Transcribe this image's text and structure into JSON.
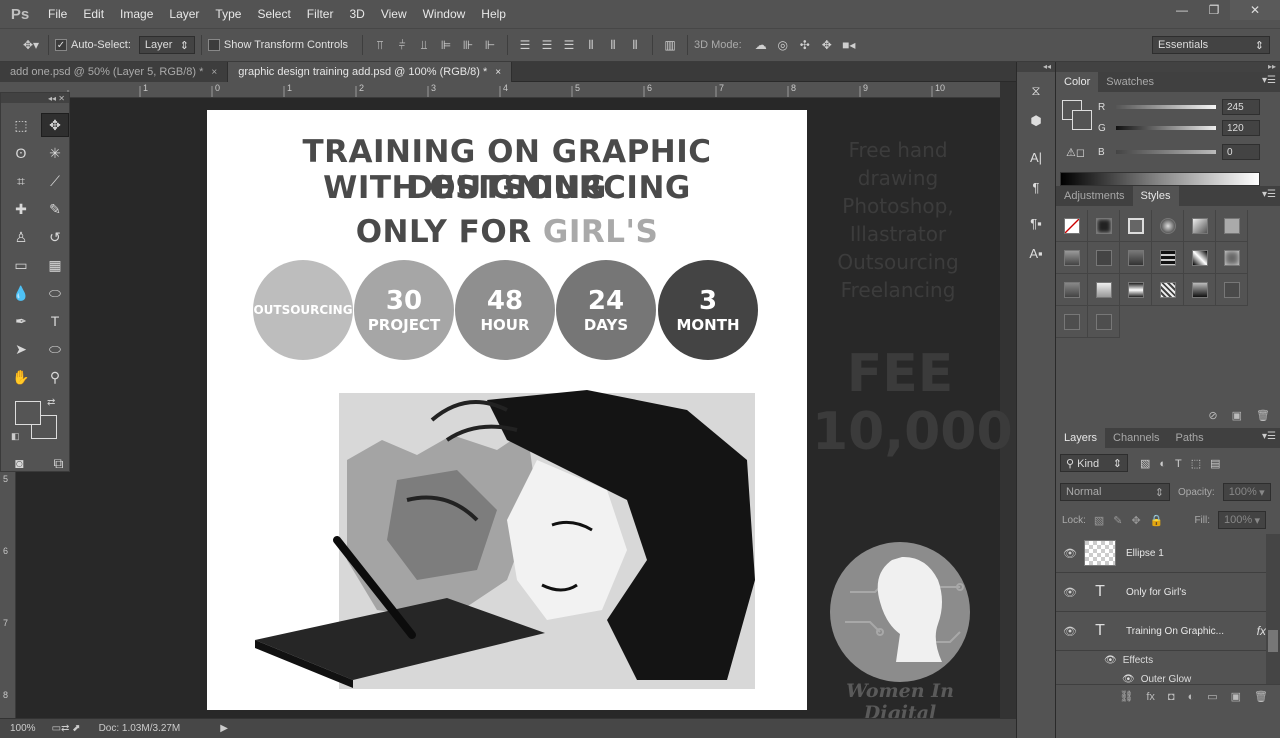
{
  "app": {
    "logo": "Ps"
  },
  "menu": [
    "File",
    "Edit",
    "Image",
    "Layer",
    "Type",
    "Select",
    "Filter",
    "3D",
    "View",
    "Window",
    "Help"
  ],
  "window_controls": {
    "minimize": "—",
    "restore": "❐",
    "close": "✕"
  },
  "options": {
    "auto_select_label": "Auto-Select:",
    "auto_select_value": "Layer",
    "show_transform_label": "Show Transform Controls",
    "mode_3d_label": "3D Mode:",
    "workspace": "Essentials"
  },
  "tabs": [
    {
      "title": "add one.psd @ 50% (Layer 5, RGB/8) *",
      "close": "×"
    },
    {
      "title": "graphic design training add.psd @ 100% (RGB/8) *",
      "close": "×"
    }
  ],
  "ruler": {
    "h": [
      "1",
      "0",
      "1",
      "2",
      "3",
      "4",
      "5",
      "6",
      "7",
      "8",
      "9",
      "10"
    ],
    "v": [
      "5",
      "6",
      "7",
      "8"
    ]
  },
  "status": {
    "zoom": "100%",
    "doc": "Doc: 1.03M/3.27M"
  },
  "poster": {
    "title1": "TRAINING ON GRAPHIC DESIGNING",
    "title2": "WITH OUTSOURCING",
    "only_for": "ONLY FOR",
    "girls": "GIRL'S",
    "circles": [
      {
        "num": "",
        "label": "OUTSOURCING",
        "color": "#bdbdbd"
      },
      {
        "num": "30",
        "label": "PROJECT",
        "color": "#a6a6a6"
      },
      {
        "num": "48",
        "label": "HOUR",
        "color": "#8f8f8f"
      },
      {
        "num": "24",
        "label": "DAYS",
        "color": "#767676"
      },
      {
        "num": "3",
        "label": "MONTH",
        "color": "#444444"
      }
    ]
  },
  "side_text": [
    "Free hand drawing",
    "Photoshop,",
    "Illastrator",
    "Outsourcing",
    "Freelancing"
  ],
  "fee": {
    "label": "FEE",
    "amount": "10,000"
  },
  "logo_text": "Women In Digital",
  "color_panel": {
    "tabs": [
      "Color",
      "Swatches"
    ],
    "r_label": "R",
    "r": "245",
    "g_label": "G",
    "g": "120",
    "b_label": "B",
    "b": "0"
  },
  "styles_panel": {
    "tabs": [
      "Adjustments",
      "Styles"
    ]
  },
  "layers_panel": {
    "tabs": [
      "Layers",
      "Channels",
      "Paths"
    ],
    "kind": "Kind",
    "blend": "Normal",
    "opacity_label": "Opacity:",
    "opacity": "100%",
    "lock_label": "Lock:",
    "fill_label": "Fill:",
    "fill": "100%",
    "layers": [
      {
        "name": "Ellipse 1",
        "thumb": ""
      },
      {
        "name": "Only for Girl's",
        "thumb": "T"
      },
      {
        "name": "Training On Graphic...",
        "thumb": "T",
        "fx": "fx"
      }
    ],
    "effects": "Effects",
    "outer_glow": "Outer Glow"
  }
}
